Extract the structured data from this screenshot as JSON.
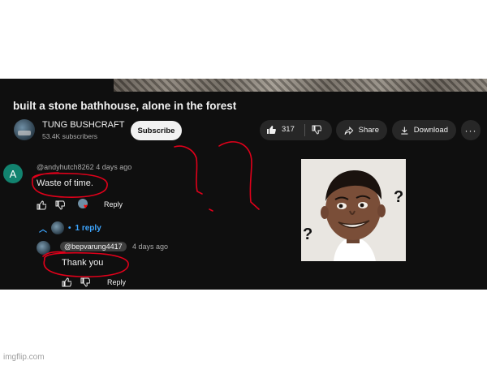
{
  "video": {
    "title": "built a stone bathhouse, alone in the forest",
    "channel_name": "TUNG BUSHCRAFT",
    "subscribers": "53.4K subscribers",
    "subscribe_label": "Subscribe",
    "like_count": "317",
    "share_label": "Share",
    "download_label": "Download",
    "more_label": "···"
  },
  "comment": {
    "avatar_letter": "A",
    "author": "@andyhutch8262",
    "time": "4 days ago",
    "text": "Waste of time.",
    "reply_label": "Reply",
    "replies_label": "1 reply"
  },
  "reply": {
    "author": "@bepvarung4417",
    "time": "4 days ago",
    "text": "Thank you",
    "reply_label": "Reply"
  },
  "meme": {
    "marks": [
      "?",
      "?"
    ]
  },
  "annotation_color": "#e0001a",
  "watermark": "imgflip.com"
}
